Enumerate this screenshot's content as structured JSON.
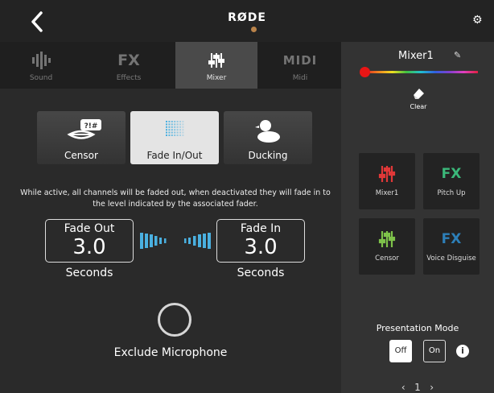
{
  "header": {
    "brand": "RØDE",
    "back_icon": "chevron-left-icon",
    "settings_icon": "gear-icon"
  },
  "tabs": [
    {
      "label": "Sound",
      "icon": "waveform-icon",
      "active": false
    },
    {
      "label": "Effects",
      "icon_text": "FX",
      "active": false
    },
    {
      "label": "Mixer",
      "icon": "sliders-icon",
      "active": true
    },
    {
      "label": "Midi",
      "icon_text": "MIDI",
      "active": false
    }
  ],
  "modes": [
    {
      "label": "Censor",
      "icon": "censor-lips-icon",
      "selected": false
    },
    {
      "label": "Fade In/Out",
      "icon": "fade-grid-icon",
      "selected": true
    },
    {
      "label": "Ducking",
      "icon": "duck-icon",
      "selected": false
    }
  ],
  "description": "While active, all channels will be faded out, when deactivated they will fade in to the level indicated by the associated fader.",
  "fade_out": {
    "title": "Fade Out",
    "value": "3.0",
    "unit": "Seconds"
  },
  "fade_in": {
    "title": "Fade In",
    "value": "3.0",
    "unit": "Seconds"
  },
  "exclude": {
    "label": "Exclude Microphone"
  },
  "side": {
    "title": "Mixer1",
    "clear_label": "Clear",
    "selected_color": "#e81515",
    "pads": [
      {
        "label": "Mixer1",
        "icon": "sliders-icon",
        "color": "#e03838"
      },
      {
        "label": "Pitch Up",
        "icon_text": "FX",
        "color": "#3bb87a"
      },
      {
        "label": "Censor",
        "icon": "sliders-icon",
        "color": "#7ec24a"
      },
      {
        "label": "Voice Disguise",
        "icon_text": "FX",
        "color": "#2d7fb8"
      }
    ],
    "presentation": {
      "label": "Presentation Mode",
      "off": "Off",
      "on": "On",
      "active": "Off"
    },
    "page": "1"
  }
}
